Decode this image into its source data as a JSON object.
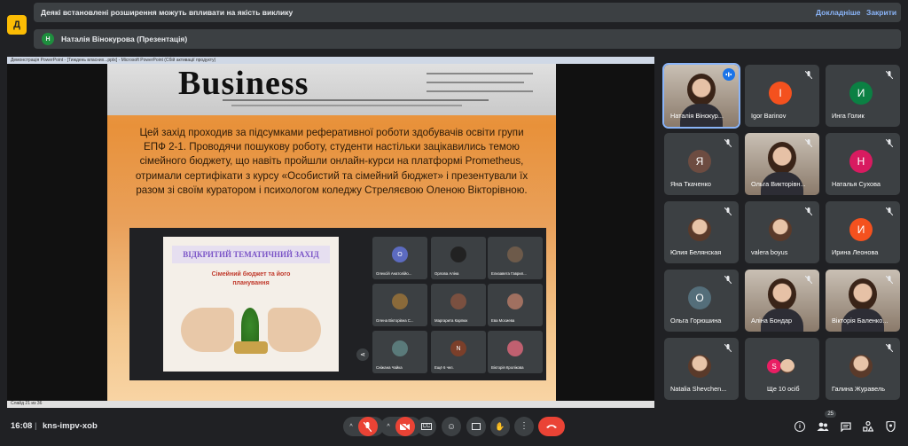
{
  "banner1": {
    "text": "Деякі встановлені розширення можуть впливати на якість виклику",
    "learn_more": "Докладніше",
    "close": "Закрити"
  },
  "banner2": {
    "avatar": "Н",
    "text": "Наталія Вінокурова (Презентація)"
  },
  "app_icon": "Д",
  "ppt": {
    "title": "Демонстрація PowerPoint - [Тиждень власних...pptx] - Microsoft PowerPoint (Сбій активації продукту)",
    "status": "Слайд 21 из 36",
    "headline": "Business",
    "paragraph": "Цей захід проходив за підсумками реферативної роботи здобувачів освіти групи ЕПФ 2-1. Проводячи пошукову роботу, студенти настільки зацікавились темою сімейного бюджету, що навіть пройшли онлайн-курси на платформі Prometheus, отримали сертифікати з курсу «Особистий та сімейний бюджет» і презентували їх разом зі своїм куратором і психологом коледжу Стреляєвою Оленою Вікторівною.",
    "inner_title": "ВІДКРИТИЙ ТЕМАТИЧНИЙ ЗАХІД",
    "inner_sub": "Сімейний бюджет та його планування",
    "inner_tiles": [
      {
        "name": "Олексій Анатолійо...",
        "letter": "О",
        "color": "#5c6bc0"
      },
      {
        "name": "Орлова Аліна",
        "letter": "",
        "color": "#222"
      },
      {
        "name": "Елизавета Гаврил...",
        "letter": "",
        "color": "#6d5a4a"
      },
      {
        "name": "Олена Вікторівна С...",
        "letter": "",
        "color": "#8a6a3a"
      },
      {
        "name": "Маргарита Карпюк",
        "letter": "",
        "color": "#7a5040"
      },
      {
        "name": "Ева Мосиева",
        "letter": "",
        "color": "#a07060"
      },
      {
        "name": "Сніжана Чайка",
        "letter": "",
        "color": "#5a7a7a"
      },
      {
        "name": "Ещё 6 чел.",
        "letter": "N",
        "color": "#7b3f2a"
      },
      {
        "name": "Вікторія Кролікова",
        "letter": "",
        "color": "#c06070"
      }
    ]
  },
  "participants": [
    {
      "name": "Наталія Вінокур...",
      "letter": "",
      "color": "",
      "photo": "big",
      "active": true
    },
    {
      "name": "Igor Barinov",
      "letter": "I",
      "color": "#f4511e"
    },
    {
      "name": "Инга Голик",
      "letter": "И",
      "color": "#0b8043"
    },
    {
      "name": "Яна Ткаченко",
      "letter": "Я",
      "color": "#6d4c41"
    },
    {
      "name": "Ольга Викторівн...",
      "letter": "",
      "color": "",
      "photo": "big"
    },
    {
      "name": "Наталья Сухова",
      "letter": "Н",
      "color": "#d81b60"
    },
    {
      "name": "Юлия Белянская",
      "letter": "",
      "color": "",
      "photo": "small"
    },
    {
      "name": "valera boyus",
      "letter": "",
      "color": "",
      "photo": "small"
    },
    {
      "name": "Ирина Леонова",
      "letter": "И",
      "color": "#f4511e"
    },
    {
      "name": "Ольга Горюшина",
      "letter": "О",
      "color": "#546e7a"
    },
    {
      "name": "Аліна Бондар",
      "letter": "",
      "color": "",
      "photo": "big"
    },
    {
      "name": "Вікторія Баленко...",
      "letter": "",
      "color": "",
      "photo": "big"
    },
    {
      "name": "Natalia Shevchen...",
      "letter": "",
      "color": "",
      "photo": "small"
    },
    {
      "name": "Ще 10 осіб",
      "letter": "S",
      "color": "#e91e63"
    },
    {
      "name": "Галина Журавель",
      "letter": "",
      "color": "",
      "photo": "small"
    }
  ],
  "bottom": {
    "time": "16:08",
    "sep": "|",
    "code": "kns-impv-xob",
    "badge": "25"
  },
  "icons": {
    "info": "info-icon",
    "people": "people-icon",
    "chat": "chat-icon",
    "activities": "activities-icon",
    "lock": "lock-icon"
  }
}
